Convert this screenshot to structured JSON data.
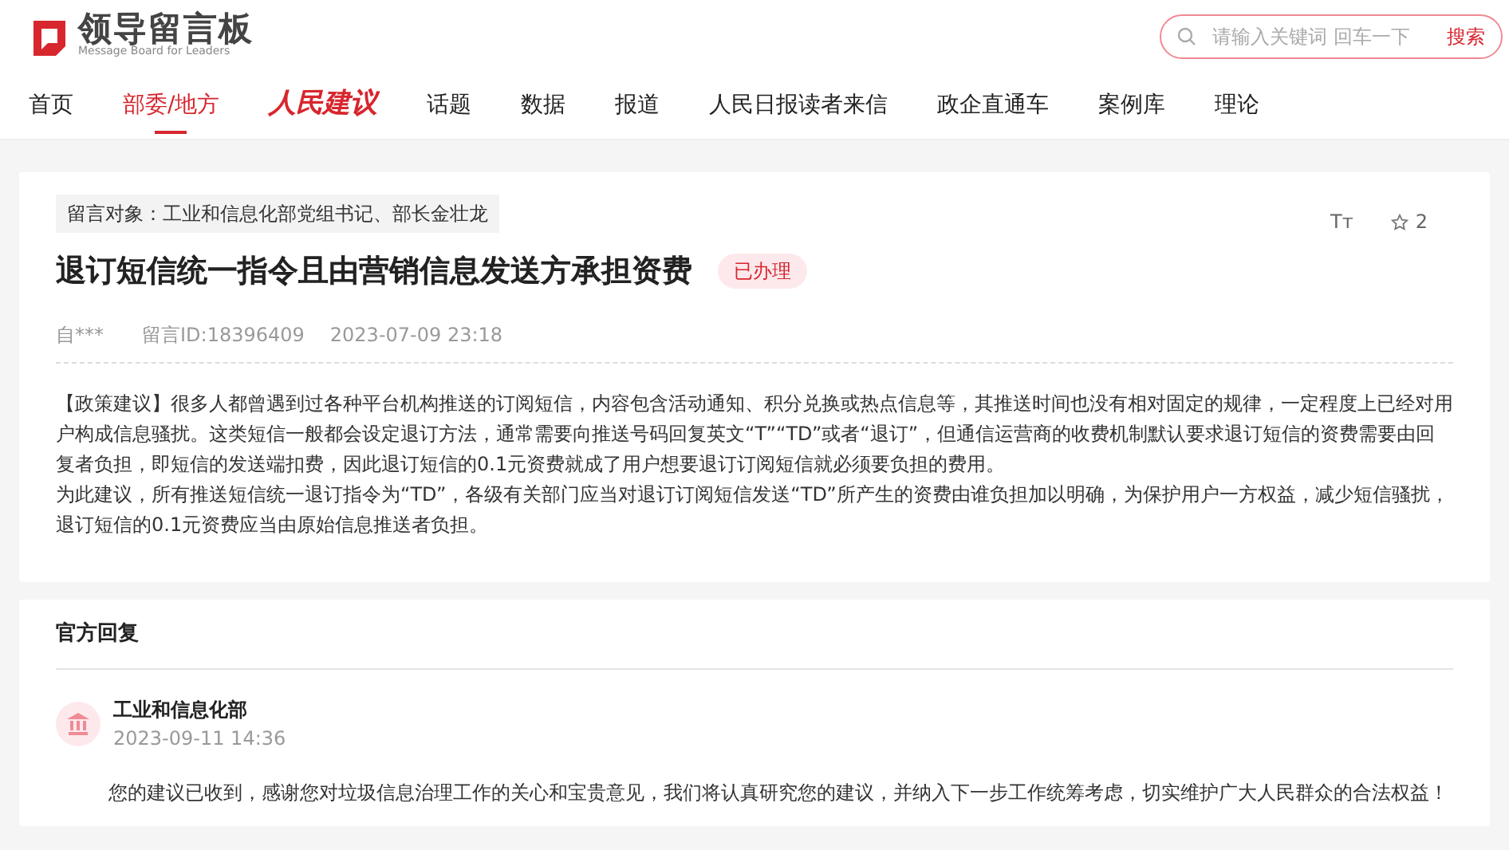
{
  "logo": {
    "title": "领导留言板",
    "subtitle": "Message Board for Leaders"
  },
  "search": {
    "placeholder": "请输入关键词 回车一下",
    "button": "搜索"
  },
  "nav": [
    {
      "label": "首页",
      "selected": false,
      "kind": "text"
    },
    {
      "label": "部委/地方",
      "selected": true,
      "kind": "text"
    },
    {
      "label": "人民建议",
      "selected": false,
      "kind": "brand"
    },
    {
      "label": "话题",
      "selected": false,
      "kind": "text"
    },
    {
      "label": "数据",
      "selected": false,
      "kind": "text"
    },
    {
      "label": "报道",
      "selected": false,
      "kind": "text"
    },
    {
      "label": "人民日报读者来信",
      "selected": false,
      "kind": "text"
    },
    {
      "label": "政企直通车",
      "selected": false,
      "kind": "text"
    },
    {
      "label": "案例库",
      "selected": false,
      "kind": "text"
    },
    {
      "label": "理论",
      "selected": false,
      "kind": "text"
    }
  ],
  "message": {
    "target": "留言对象：工业和信息化部党组书记、部长金壮龙",
    "title": "退订短信统一指令且由营销信息发送方承担资费",
    "status": "已办理",
    "font_toggle": "Tт",
    "favorites": "2",
    "author": "自***",
    "message_id": "留言ID:18396409",
    "time": "2023-07-09 23:18",
    "paragraphs": [
      "【政策建议】很多人都曾遇到过各种平台机构推送的订阅短信，内容包含活动通知、积分兑换或热点信息等，其推送时间也没有相对固定的规律，一定程度上已经对用户构成信息骚扰。这类短信一般都会设定退订方法，通常需要向推送号码回复英文“T”“TD”或者“退订”，但通信运营商的收费机制默认要求退订短信的资费需要由回复者负担，即短信的发送端扣费，因此退订短信的0.1元资费就成了用户想要退订订阅短信就必须要负担的费用。",
      "为此建议，所有推送短信统一退订指令为“TD”，各级有关部门应当对退订订阅短信发送“TD”所产生的资费由谁负担加以明确，为保护用户一方权益，减少短信骚扰，退订短信的0.1元资费应当由原始信息推送者负担。"
    ]
  },
  "reply": {
    "heading": "官方回复",
    "department": "工业和信息化部",
    "time": "2023-09-11 14:36",
    "text": "您的建议已收到，感谢您对垃圾信息治理工作的关心和宝贵意见，我们将认真研究您的建议，并纳入下一步工作统筹考虑，切实维护广大人民群众的合法权益！"
  }
}
